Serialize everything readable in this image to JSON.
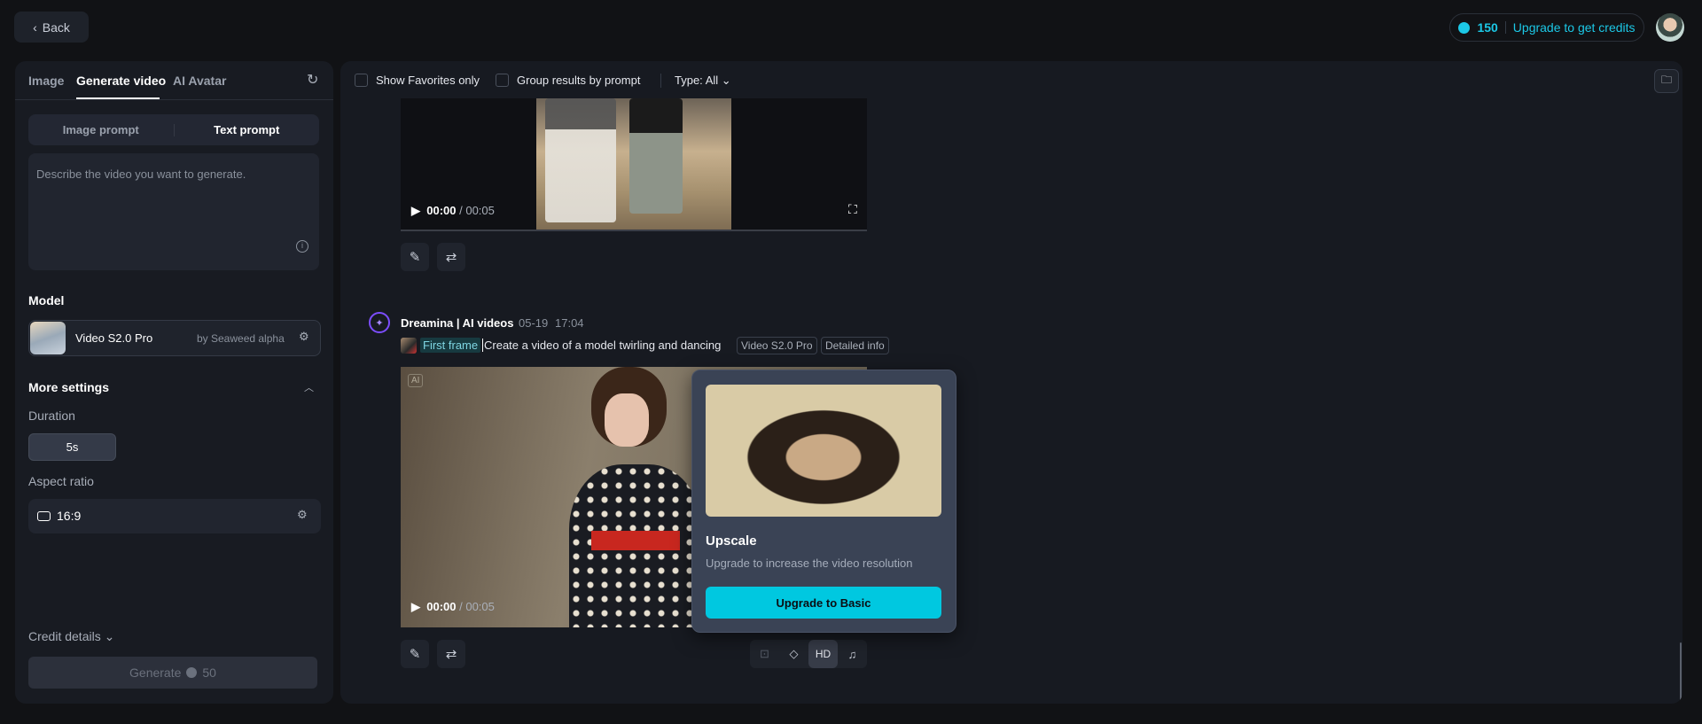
{
  "header": {
    "back_label": "Back",
    "credits": "150",
    "upgrade_credits": "Upgrade to get credits"
  },
  "left": {
    "tabs": [
      "Image",
      "Generate video",
      "AI Avatar"
    ],
    "prompt_modes": [
      "Image prompt",
      "Text prompt"
    ],
    "prompt_placeholder": "Describe the video you want to generate.",
    "model_label": "Model",
    "model_name": "Video S2.0 Pro",
    "model_by": "by Seaweed alpha",
    "more_settings": "More settings",
    "duration_label": "Duration",
    "duration_value": "5s",
    "aspect_label": "Aspect ratio",
    "aspect_value": "16:9",
    "credit_details": "Credit details",
    "generate_label": "Generate",
    "generate_cost": "50"
  },
  "toolbar": {
    "show_favorites": "Show Favorites only",
    "group_results": "Group results by prompt",
    "type_filter": "Type: All"
  },
  "feed": {
    "video1": {
      "time": "00:00",
      "duration": "00:05"
    },
    "message": {
      "author": "Dreamina | AI videos",
      "date": "05-19",
      "time": "17:04",
      "first_frame": "First frame",
      "prompt": "Create a video of a model twirling and dancing",
      "tag_model": "Video S2.0 Pro",
      "tag_info": "Detailed info"
    },
    "video2": {
      "badge": "AI",
      "time": "00:00",
      "duration": "00:05"
    },
    "actions": {
      "hd": "HD"
    }
  },
  "popup": {
    "title": "Upscale",
    "subtitle": "Upgrade to increase the video resolution",
    "button": "Upgrade to Basic"
  }
}
